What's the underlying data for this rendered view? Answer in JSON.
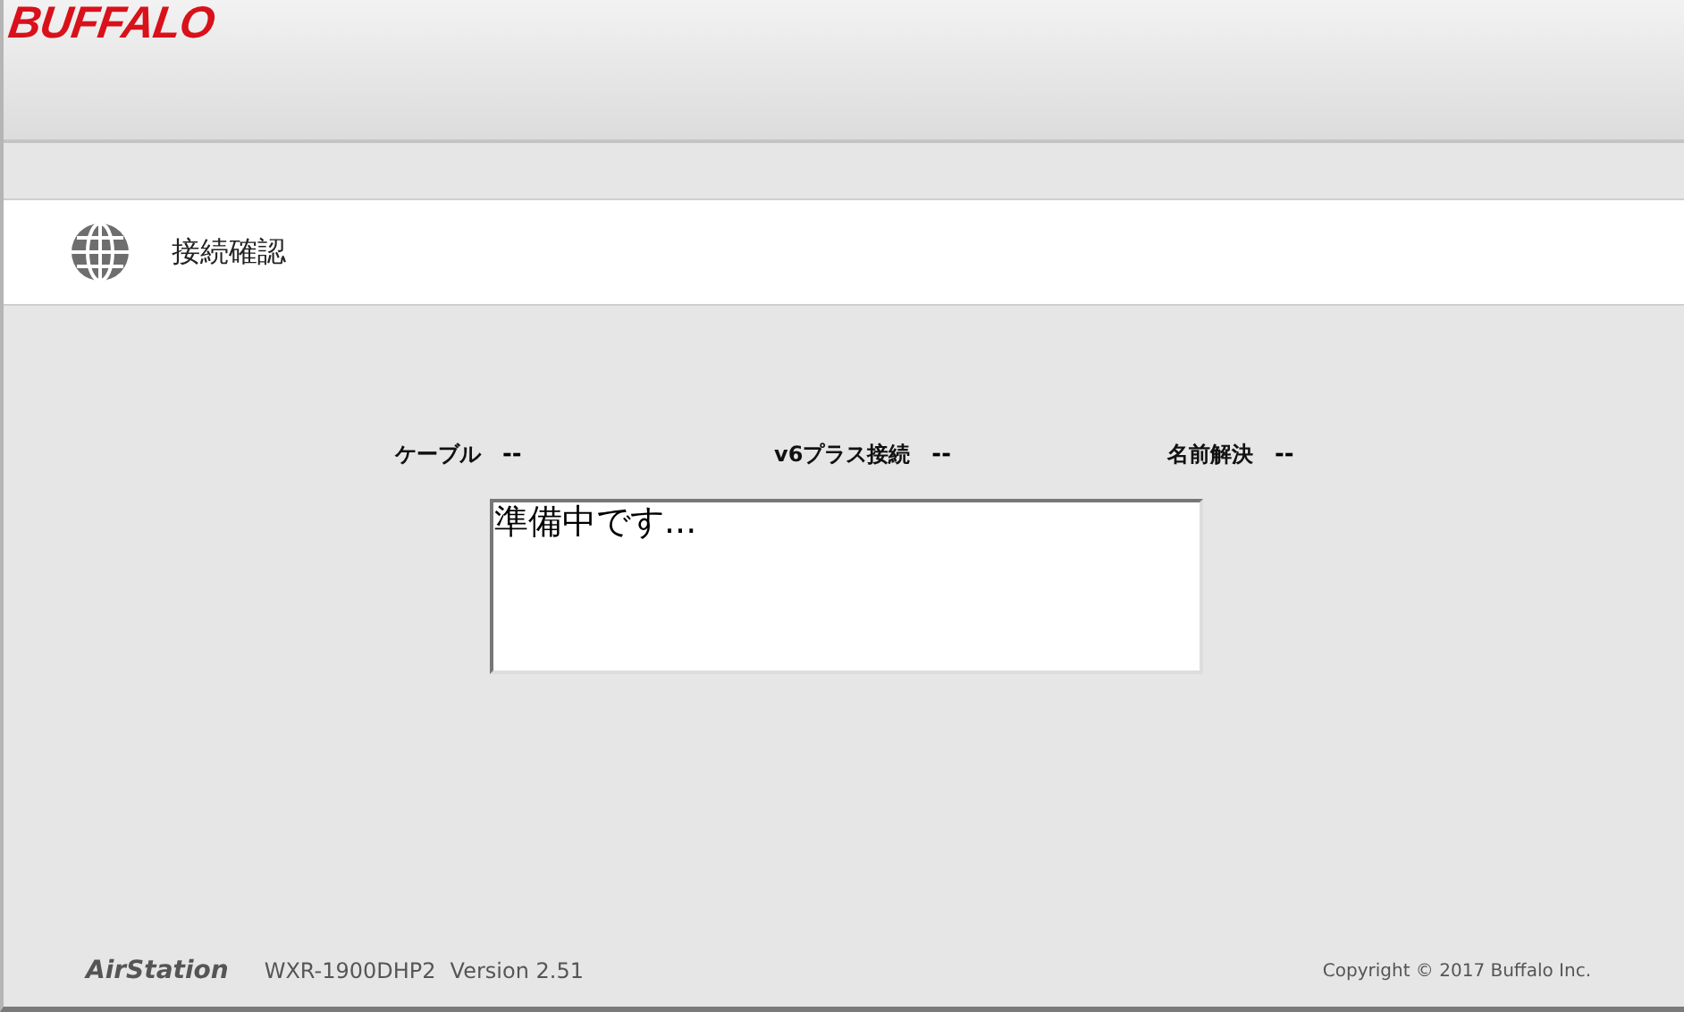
{
  "header": {
    "logo": "BUFFALO"
  },
  "page": {
    "title": "接続確認"
  },
  "status": [
    {
      "label": "ケーブル",
      "value": "--"
    },
    {
      "label": "v6プラス接続",
      "value": "--"
    },
    {
      "label": "名前解決",
      "value": "--"
    }
  ],
  "message": "準備中です...",
  "footer": {
    "product": "AirStation",
    "model": "WXR-1900DHP2",
    "version": "Version 2.51",
    "copyright": "Copyright © 2017 Buffalo Inc."
  }
}
